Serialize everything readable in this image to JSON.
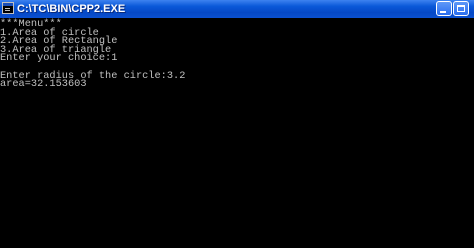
{
  "window": {
    "title": "C:\\TC\\BIN\\CPP2.EXE",
    "icon": "console-app-icon"
  },
  "title_buttons": {
    "minimize": "minimize-icon",
    "maximize": "maximize-icon"
  },
  "colors": {
    "titlebar": "#0548c6",
    "console_background": "#000000",
    "console_text": "#c0c0c0"
  },
  "console": {
    "lines": [
      "***Menu***",
      "1.Area of circle",
      "2.Area of Rectangle",
      "3.Area of triangle",
      "Enter your choice:1",
      "",
      "Enter radius of the circle:3.2",
      "area=32.153603"
    ]
  }
}
